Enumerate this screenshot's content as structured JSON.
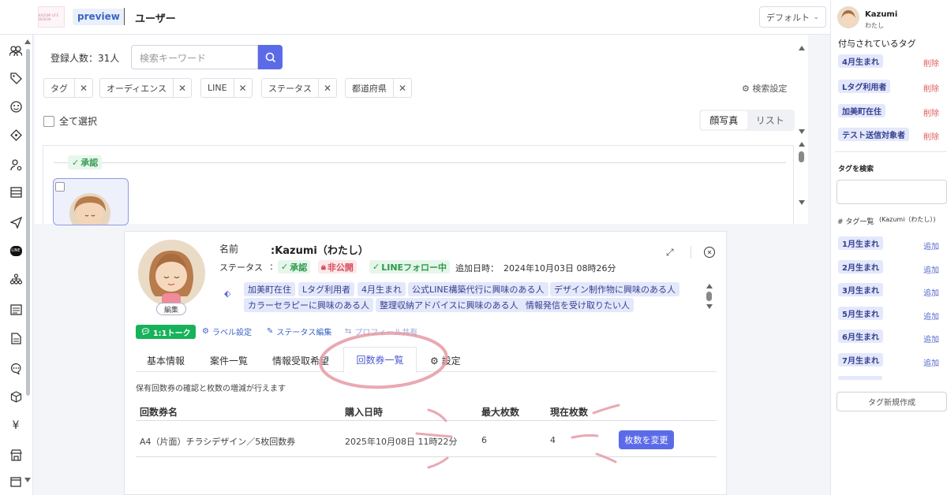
{
  "header": {
    "logo_text": "KAZUMI LIFE DESIGN",
    "preview_label": "preview",
    "title": "ユーザー",
    "view_select": "デフォルト"
  },
  "search": {
    "count_label": "登録人数：",
    "count": "31人",
    "placeholder": "検索キーワード",
    "settings_label": "検索設定"
  },
  "filters": [
    "タグ",
    "オーディエンス",
    "LINE",
    "ステータス",
    "都道府県"
  ],
  "list": {
    "select_all": "全て選択",
    "view_photo": "顔写真",
    "view_list": "リスト",
    "group_label": "承認"
  },
  "profile": {
    "name_label": "名前",
    "name_value": ":Kazumi（わたし）",
    "status_label": "ステータス",
    "status_colon": ":",
    "badges": [
      "承認",
      "非公開",
      "LINEフォロー中"
    ],
    "added_label": "追加日時：",
    "added_value": "2024年10月03日 08時26分",
    "edit_label": "編集",
    "tags_row1": [
      "加美町在住",
      "Lタグ利用者",
      "4月生まれ",
      "公式LINE構築代行に興味のある人",
      "デザイン制作物に興味のある人"
    ],
    "tags_row2": [
      "カラーセラピーに興味のある人",
      "整理収納アドバイスに興味のある人",
      "情報発信を受け取りたい人"
    ],
    "actions": {
      "talk": "1:1トーク",
      "label_settings": "ラベル設定",
      "status_edit": "ステータス編集",
      "share": "プロフィール共有"
    }
  },
  "tabs": {
    "basic": "基本情報",
    "cases": "案件一覧",
    "info": "情報受取希望",
    "tickets": "回数券一覧",
    "settings": "設定"
  },
  "tickets": {
    "description": "保有回数券の確認と枚数の増減が行えます",
    "columns": [
      "回数券名",
      "購入日時",
      "最大枚数",
      "現在枚数"
    ],
    "rows": [
      {
        "name": "A4（片面）チラシデザイン／5枚回数券",
        "date": "2025年10月08日 11時22分",
        "max": "6",
        "current": "4",
        "button": "枚数を変更"
      }
    ]
  },
  "right_panel": {
    "user_name": "Kazumi",
    "user_sub": "わたし",
    "assigned_heading": "付与されているタグ",
    "assigned": [
      "4月生まれ",
      "Lタグ利用者",
      "加美町在住",
      "テスト送信対象者"
    ],
    "delete_label": "削除",
    "search_heading": "タグを検索",
    "list_heading": "# タグ一覧",
    "list_sub": "(Kazumi（わたし）)",
    "tag_list": [
      "1月生まれ",
      "2月生まれ",
      "3月生まれ",
      "5月生まれ",
      "6月生まれ",
      "7月生まれ"
    ],
    "add_label": "追加",
    "new_tag": "タグ新規作成"
  }
}
